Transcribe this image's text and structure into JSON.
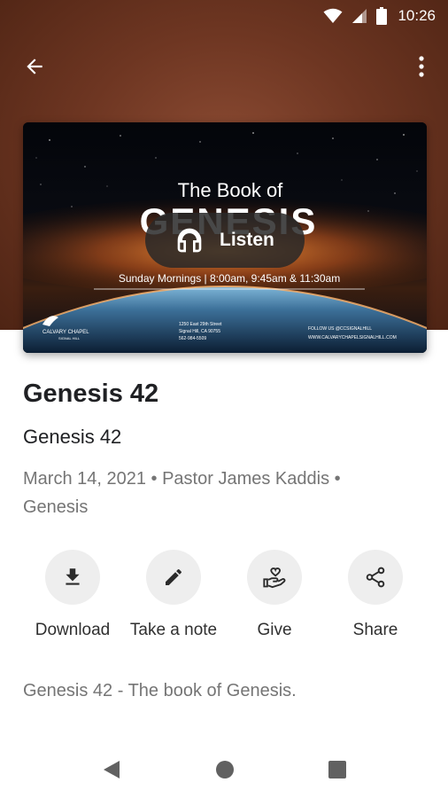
{
  "status_bar": {
    "time": "10:26"
  },
  "app_bar": {
    "back_icon": "arrow-back-icon",
    "more_icon": "more-vert-icon"
  },
  "artwork": {
    "heading_small": "The Book of",
    "heading_large": "GENESIS",
    "schedule": "Sunday Mornings | 8:00am, 9:45am & 11:30am",
    "church_name_line1": "CALVARY CHAPEL",
    "church_name_line2": "SIGNAL HILL",
    "address_line1": "1250 East 29th Street",
    "address_line2": "Signal Hill, CA 90755",
    "address_line3": "562-984-5509",
    "social_line1": "FOLLOW US @CCSIGNALHILL",
    "social_line2": "WWW.CALVARYCHAPELSIGNALHILL.COM"
  },
  "listen_button": {
    "label": "Listen",
    "icon": "headphones-icon"
  },
  "sermon": {
    "title": "Genesis 42",
    "subtitle": "Genesis 42",
    "meta_line1": "March 14, 2021 • Pastor James  Kaddis •",
    "meta_line2": "Genesis",
    "description": "Genesis 42 - The book of Genesis."
  },
  "actions": [
    {
      "label": "Download",
      "icon": "download-icon"
    },
    {
      "label": "Take a note",
      "icon": "pencil-icon"
    },
    {
      "label": "Give",
      "icon": "give-hand-heart-icon"
    },
    {
      "label": "Share",
      "icon": "share-icon"
    }
  ],
  "colors": {
    "hero": "#6e3622",
    "text_primary": "#202124",
    "text_secondary": "#757575",
    "action_bg": "#eeeeee"
  }
}
